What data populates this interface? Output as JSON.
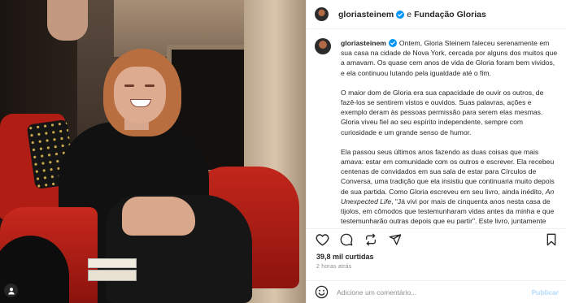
{
  "header": {
    "username": "gloriasteinem",
    "connector": "e",
    "collaborator": "Fundação Glorias"
  },
  "caption": {
    "username": "gloriasteinem",
    "paragraphs": [
      "Ontem, Gloria Steinem faleceu serenamente em sua casa na cidade de Nova York, cercada por alguns dos muitos que a amavam. Os quase cem anos de vida de Gloria foram bem vividos, e ela continuou lutando pela igualdade até o fim.",
      "O maior dom de Gloria era sua capacidade de ouvir os outros, de fazê-los se sentirem vistos e ouvidos. Suas palavras, ações e exemplo deram às pessoas permissão para serem elas mesmas. Gloria viveu fiel ao seu espírito independente, sempre com curiosidade e um grande senso de humor."
    ],
    "p3_before_book": "Ela passou seus últimos anos fazendo as duas coisas que mais amava: estar em comunidade com os outros e escrever. Ela recebeu centenas de convidados em sua sala de estar para Círculos de Conversa, uma tradição que ela insistiu que continuaria muito depois de sua partida. Como Gloria escreveu em seu livro, ainda inédito, ",
    "p3_book": "An Unexpected Life",
    "p3_after_book": ", \"Já vivi por mais de cinquenta anos nesta casa de tijolos, em cômodos que testemunharam vidas antes da minha e que testemunharão outras depois que eu partir\". Este livro, juntamente com seu"
  },
  "actions": {
    "icons": [
      "heart-icon",
      "comment-icon",
      "repost-icon",
      "share-icon",
      "save-icon"
    ]
  },
  "stats": {
    "likes": "39,8 mil curtidas",
    "time": "2 horas atrás"
  },
  "comment": {
    "placeholder": "Adicione um comentário...",
    "publish_label": "Publicar"
  },
  "colors": {
    "verified": "#0095f6",
    "publish_disabled": "#b3dbff",
    "chair_red": "#b01d15"
  }
}
